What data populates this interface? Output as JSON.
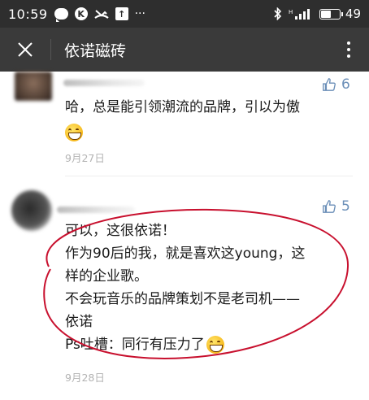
{
  "status_bar": {
    "time": "10:59",
    "battery_level": "49",
    "battery_fraction": 0.49,
    "icons": [
      "chat-bubble-icon",
      "k-app-icon",
      "missed-call-icon",
      "upload-icon",
      "more-dots-icon",
      "bluetooth-icon",
      "signal-icon",
      "battery-icon"
    ]
  },
  "nav": {
    "title": "依诺磁砖"
  },
  "comments": [
    {
      "likes": "6",
      "lines": [
        "哈，总是能引领潮流的品牌，引以为傲"
      ],
      "emoji": "grin-emoji",
      "date": "9月27日"
    },
    {
      "likes": "5",
      "lines": [
        "可以，这很依诺！",
        "作为90后的我，就是喜欢这young，这",
        "样的企业歌。",
        "不会玩音乐的品牌策划不是老司机——",
        "依诺",
        "Ps吐槽：同行有压力了"
      ],
      "emoji": "grin-emoji",
      "date": "9月28日"
    }
  ],
  "colors": {
    "status_bar": "#2e2e2e",
    "nav_bar": "#3a3a3a",
    "like_blue": "#6b8fb8",
    "annotation_red": "#c8102e",
    "date_gray": "#b3b3b3"
  }
}
